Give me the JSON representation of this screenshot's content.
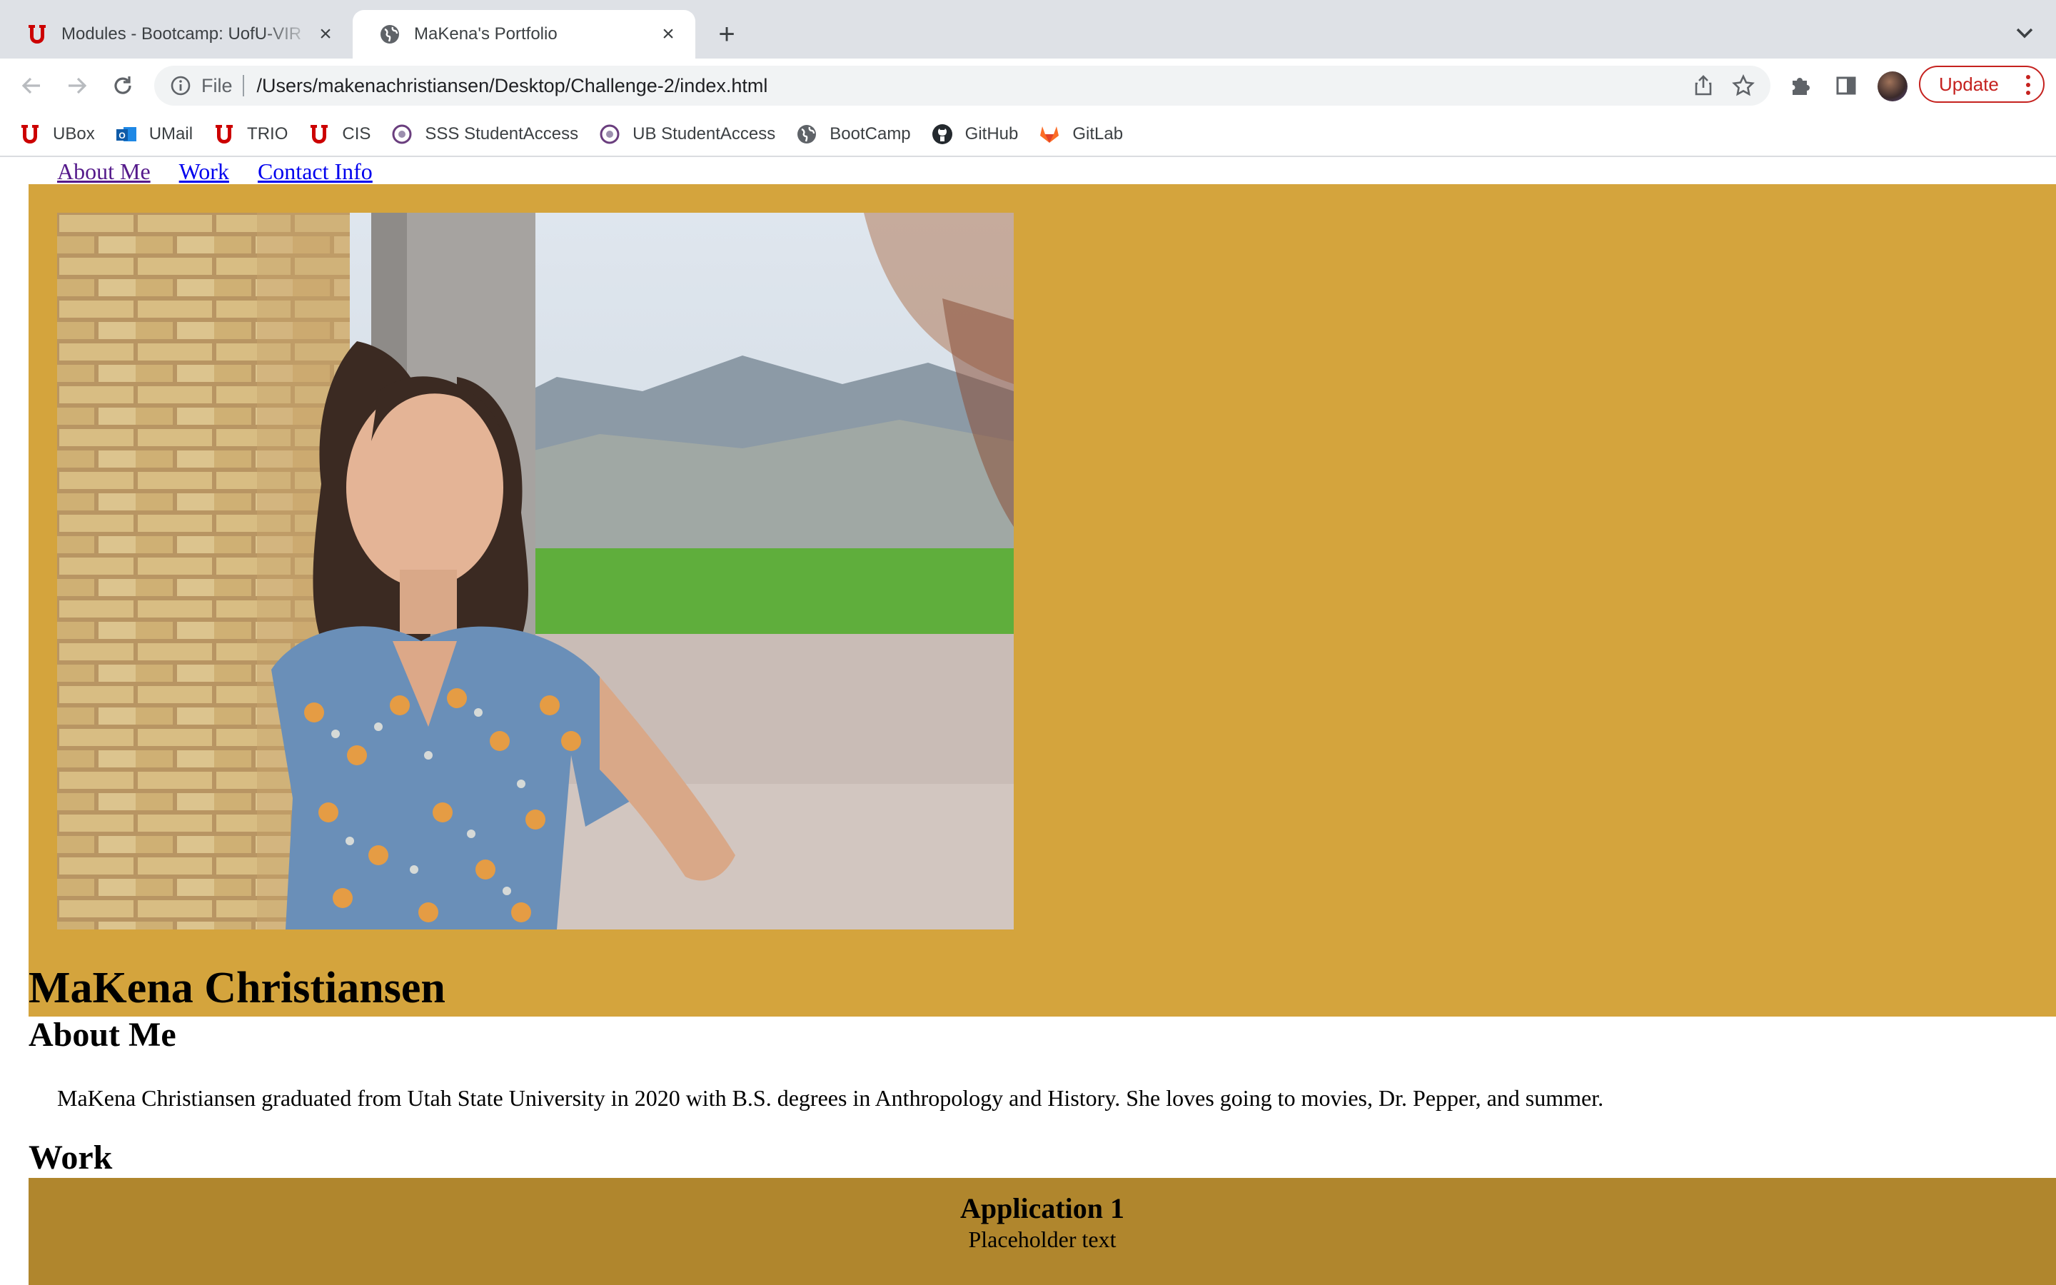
{
  "browser": {
    "tabs": [
      {
        "title": "Modules - Bootcamp: UofU-VIR",
        "active": false,
        "icon": "utah-u-icon"
      },
      {
        "title": "MaKena's Portfolio",
        "active": true,
        "icon": "globe-icon"
      }
    ],
    "address": {
      "scheme_label": "File",
      "url": "/Users/makenachristiansen/Desktop/Challenge-2/index.html"
    },
    "update_label": "Update",
    "bookmarks": [
      {
        "label": "UBox",
        "icon": "utah-u-icon"
      },
      {
        "label": "UMail",
        "icon": "outlook-icon"
      },
      {
        "label": "TRIO",
        "icon": "utah-u-icon"
      },
      {
        "label": "CIS",
        "icon": "utah-u-icon"
      },
      {
        "label": "SSS StudentAccess",
        "icon": "studentaccess-icon"
      },
      {
        "label": "UB StudentAccess",
        "icon": "studentaccess-icon"
      },
      {
        "label": "BootCamp",
        "icon": "globe-icon"
      },
      {
        "label": "GitHub",
        "icon": "github-icon"
      },
      {
        "label": "GitLab",
        "icon": "gitlab-icon"
      }
    ]
  },
  "site": {
    "nav": [
      "About Me",
      "Work",
      "Contact Info"
    ],
    "header_name": "MaKena Christiansen",
    "about_heading": "About Me",
    "about_text": "MaKena Christiansen graduated from Utah State University in 2020 with B.S. degrees in Anthropology and History. She loves going to movies, Dr. Pepper, and summer.",
    "work_heading": "Work",
    "work_items": [
      {
        "title": "Application 1",
        "text": "Placeholder text"
      }
    ]
  },
  "colors": {
    "hero_bg": "#d4a43d",
    "work_bg": "#b0862d",
    "update_red": "#c5221f"
  }
}
